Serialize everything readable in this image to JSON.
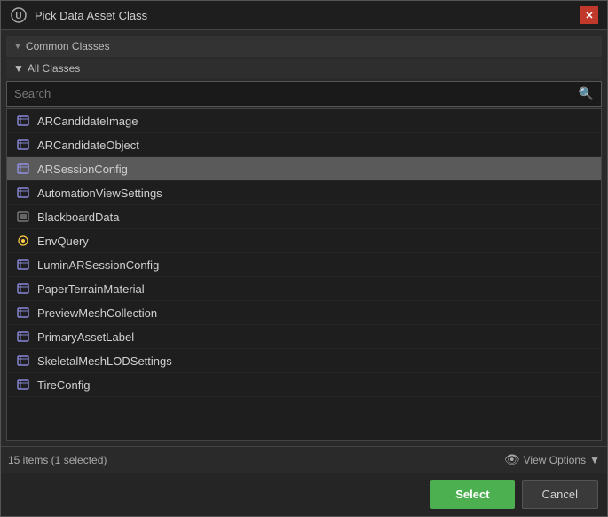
{
  "titleBar": {
    "title": "Pick Data Asset Class",
    "closeLabel": "✕"
  },
  "sections": {
    "commonClasses": "Common Classes",
    "allClasses": "All Classes"
  },
  "search": {
    "placeholder": "Search"
  },
  "listItems": [
    {
      "id": 1,
      "label": "ARCandidateImage",
      "iconType": "data",
      "selected": false
    },
    {
      "id": 2,
      "label": "ARCandidateObject",
      "iconType": "data",
      "selected": false
    },
    {
      "id": 3,
      "label": "ARSessionConfig",
      "iconType": "data",
      "selected": true
    },
    {
      "id": 4,
      "label": "AutomationViewSettings",
      "iconType": "data",
      "selected": false
    },
    {
      "id": 5,
      "label": "BlackboardData",
      "iconType": "blackboard",
      "selected": false
    },
    {
      "id": 6,
      "label": "EnvQuery",
      "iconType": "env",
      "selected": false
    },
    {
      "id": 7,
      "label": "LuminARSessionConfig",
      "iconType": "data",
      "selected": false
    },
    {
      "id": 8,
      "label": "PaperTerrainMaterial",
      "iconType": "data",
      "selected": false
    },
    {
      "id": 9,
      "label": "PreviewMeshCollection",
      "iconType": "data",
      "selected": false
    },
    {
      "id": 10,
      "label": "PrimaryAssetLabel",
      "iconType": "data",
      "selected": false
    },
    {
      "id": 11,
      "label": "SkeletalMeshLODSettings",
      "iconType": "data",
      "selected": false
    },
    {
      "id": 12,
      "label": "TireConfig",
      "iconType": "data",
      "selected": false
    }
  ],
  "footer": {
    "statusText": "15 items (1 selected)",
    "viewOptionsLabel": "View Options"
  },
  "buttons": {
    "selectLabel": "Select",
    "cancelLabel": "Cancel"
  }
}
